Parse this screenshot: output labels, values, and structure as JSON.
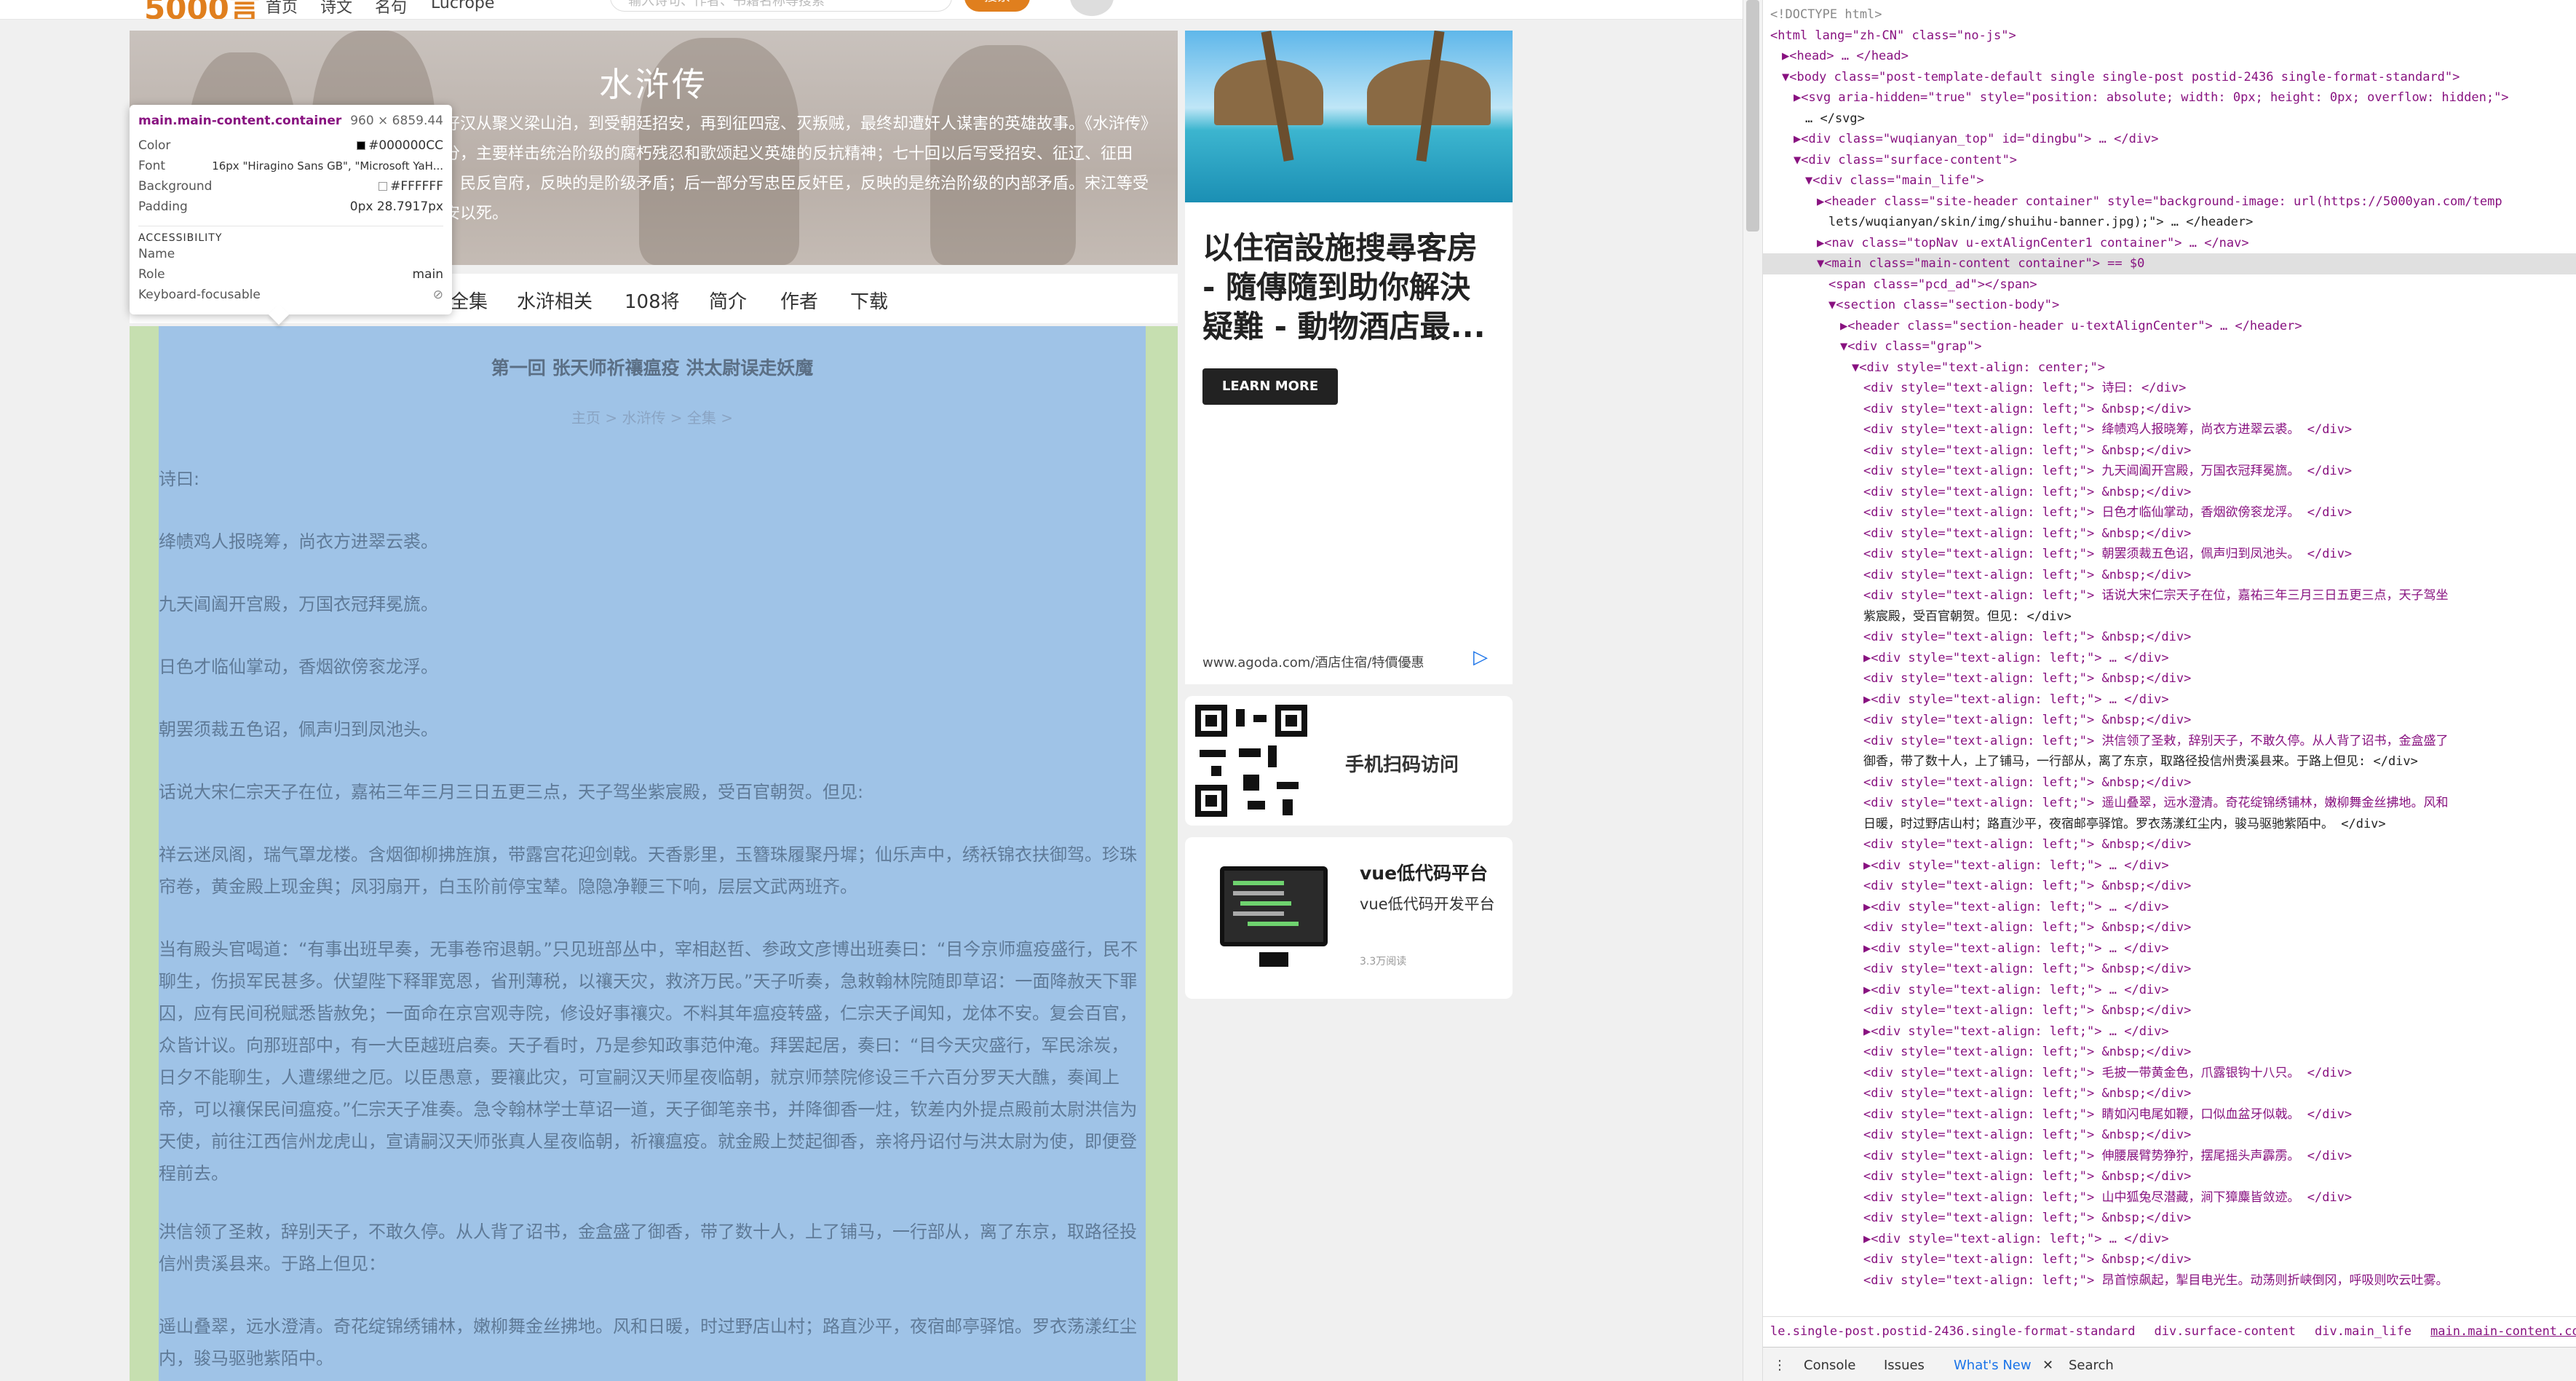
{
  "topbar": {
    "logo": "5000言",
    "nav": [
      "首页",
      "诗文",
      "名句",
      "Lucrope"
    ],
    "search_placeholder": "输入诗句、作者、书籍名称等搜索",
    "search_button": "搜索"
  },
  "banner": {
    "title": "水浒传",
    "text": "八好汉从聚义梁山泊，到受朝廷招安，再到征四寇、灭叛贼，最终却遭奸人谋害的英雄故事。《水浒传》部分，主要样击统治阶级的腐朽残忍和歌颂起义英雄的反抗精神；七十回以后写受招安、征辽、征田虎、民反官府，反映的是阶级矛盾；后一部分写忠臣反奸臣，反映的是统治阶级的内部矛盾。宋江等受招安以死。"
  },
  "tooltip": {
    "selector": "main.main-content.container",
    "dimensions": "960 × 6859.44",
    "rows": [
      {
        "k": "Color",
        "v": "#000000CC"
      },
      {
        "k": "Font",
        "v": "16px \"Hiragino Sans GB\", \"Microsoft YaH..."
      },
      {
        "k": "Background",
        "v": "#FFFFFF"
      },
      {
        "k": "Padding",
        "v": "0px 28.7917px"
      }
    ],
    "section": "ACCESSIBILITY",
    "acc_rows": [
      {
        "k": "Name",
        "v": ""
      },
      {
        "k": "Role",
        "v": "main"
      },
      {
        "k": "Keyboard-focusable",
        "v": "⊘"
      }
    ]
  },
  "subnav": [
    "全集",
    "水浒相关",
    "108将",
    "简介",
    "作者",
    "下载"
  ],
  "article": {
    "chapter_title": "第一回 张天师祈禳瘟疫 洪太尉误走妖魔",
    "breadcrumb": "主页 > 水浒传 > 全集 >",
    "paragraphs": [
      "诗曰:",
      "绛帻鸡人报晓筹，尚衣方进翠云裘。",
      "九天阊阖开宫殿，万国衣冠拜冕旒。",
      "日色才临仙掌动，香烟欲傍衮龙浮。",
      "朝罢须裁五色诏，佩声归到凤池头。",
      "话说大宋仁宗天子在位，嘉祐三年三月三日五更三点，天子驾坐紫宸殿，受百官朝贺。但见:",
      "祥云迷凤阁，瑞气罩龙楼。含烟御柳拂旌旗，带露宫花迎剑戟。天香影里，玉簪珠履聚丹墀；仙乐声中，绣袄锦衣扶御驾。珍珠帘卷，黄金殿上现金舆；凤羽扇开，白玉阶前停宝辇。隐隐净鞭三下响，层层文武两班齐。",
      "当有殿头官喝道：“有事出班早奏，无事卷帘退朝。”只见班部丛中，宰相赵哲、参政文彦博出班奏曰：“目今京师瘟疫盛行，民不聊生，伤损军民甚多。伏望陛下释罪宽恩，省刑薄税，以禳天灾，救济万民。”天子听奏，急敕翰林院随即草诏：一面降赦天下罪囚，应有民间税赋悉皆赦免；一面命在京宫观寺院，修设好事禳灾。不料其年瘟疫转盛，仁宗天子闻知，龙体不安。复会百官，众皆计议。向那班部中，有一大臣越班启奏。天子看时，乃是参知政事范仲淹。拜罢起居，奏曰：“目今天灾盛行，军民涂炭，日夕不能聊生，人遭缧绁之厄。以臣愚意，要禳此灾，可宣嗣汉天师星夜临朝，就京师禁院修设三千六百分罗天大醮，奏闻上帝，可以禳保民间瘟疫。”仁宗天子准奏。急令翰林学士草诏一道，天子御笔亲书，并降御香一炷，钦差内外提点殿前太尉洪信为天使，前往江西信州龙虎山，宣请嗣汉天师张真人星夜临朝，祈禳瘟疫。就金殿上焚起御香，亲将丹诏付与洪太尉为使，即便登程前去。",
      "洪信领了圣敕，辞别天子，不敢久停。从人背了诏书，金盒盛了御香，带了数十人，上了铺马，一行部从，离了东京，取路径投信州贵溪县来。于路上但见：",
      "遥山叠翠，远水澄清。奇花绽锦绣铺林，嫩柳舞金丝拂地。风和日暖，时过野店山村；路直沙平，夜宿邮亭驿馆。罗衣荡漾红尘内，骏马驱驰紫陌中。"
    ]
  },
  "ads": {
    "hotel_headline": "以住宿設施搜尋客房 - 隨傳隨到助你解決疑難 - 動物酒店最...",
    "hotel_cta": "LEARN MORE",
    "hotel_url": "www.agoda.com/酒店住宿/特價優惠",
    "qr_label": "手机扫码访问",
    "vue_title": "vue低代码平台",
    "vue_desc": "vue低代码开发平台",
    "vue_views": "3.3万阅读"
  },
  "devtools": {
    "lines": [
      {
        "i": 0,
        "t": "<!DOCTYPE html>",
        "k": "doctype"
      },
      {
        "i": 0,
        "t": "<html lang=\"zh-CN\" class=\"no-js\">",
        "k": "open"
      },
      {
        "i": 1,
        "t": "▶<head> … </head>",
        "k": "closed"
      },
      {
        "i": 1,
        "t": "▼<body class=\"post-template-default single single-post postid-2436 single-format-standard\">",
        "k": "open"
      },
      {
        "i": 2,
        "t": "▶<svg aria-hidden=\"true\" style=\"position: absolute; width: 0px; height: 0px; overflow: hidden;\">",
        "k": "closed"
      },
      {
        "i": 3,
        "t": "… </svg>",
        "k": "text"
      },
      {
        "i": 2,
        "t": "▶<div class=\"wuqianyan_top\" id=\"dingbu\"> … </div>",
        "k": "closed"
      },
      {
        "i": 2,
        "t": "▼<div class=\"surface-content\">",
        "k": "open"
      },
      {
        "i": 3,
        "t": "▼<div class=\"main_life\">",
        "k": "open"
      },
      {
        "i": 4,
        "t": "▶<header class=\"site-header container\" style=\"background-image: url(https://5000yan.com/temp",
        "k": "closed"
      },
      {
        "i": 5,
        "t": "lets/wuqianyan/skin/img/shuihu-banner.jpg);\"> … </header>",
        "k": "text"
      },
      {
        "i": 4,
        "t": "▶<nav class=\"topNav u-extAlignCenter1 container\"> … </nav>",
        "k": "closed"
      },
      {
        "i": 4,
        "t": "▼<main class=\"main-content container\"> == $0",
        "k": "sel"
      },
      {
        "i": 5,
        "t": "<span class=\"pcd_ad\"></span>",
        "k": "open"
      },
      {
        "i": 5,
        "t": "▼<section class=\"section-body\">",
        "k": "open"
      },
      {
        "i": 6,
        "t": "▶<header class=\"section-header u-textAlignCenter\"> … </header>",
        "k": "closed"
      },
      {
        "i": 6,
        "t": "▼<div class=\"grap\">",
        "k": "open"
      },
      {
        "i": 7,
        "t": "▼<div style=\"text-align: center;\">",
        "k": "open"
      },
      {
        "i": 8,
        "t": "<div style=\"text-align: left;\"> 诗曰: </div>",
        "k": "leaf"
      },
      {
        "i": 8,
        "t": "<div style=\"text-align: left;\"> &nbsp;</div>",
        "k": "leaf"
      },
      {
        "i": 8,
        "t": "<div style=\"text-align: left;\"> 绛帻鸡人报晓筹，尚衣方进翠云裘。 </div>",
        "k": "leaf"
      },
      {
        "i": 8,
        "t": "<div style=\"text-align: left;\"> &nbsp;</div>",
        "k": "leaf"
      },
      {
        "i": 8,
        "t": "<div style=\"text-align: left;\"> 九天阊阖开宫殿，万国衣冠拜冕旒。 </div>",
        "k": "leaf"
      },
      {
        "i": 8,
        "t": "<div style=\"text-align: left;\"> &nbsp;</div>",
        "k": "leaf"
      },
      {
        "i": 8,
        "t": "<div style=\"text-align: left;\"> 日色才临仙掌动，香烟欲傍衮龙浮。 </div>",
        "k": "leaf"
      },
      {
        "i": 8,
        "t": "<div style=\"text-align: left;\"> &nbsp;</div>",
        "k": "leaf"
      },
      {
        "i": 8,
        "t": "<div style=\"text-align: left;\"> 朝罢须裁五色诏，佩声归到凤池头。 </div>",
        "k": "leaf"
      },
      {
        "i": 8,
        "t": "<div style=\"text-align: left;\"> &nbsp;</div>",
        "k": "leaf"
      },
      {
        "i": 8,
        "t": "<div style=\"text-align: left;\"> 话说大宋仁宗天子在位，嘉祐三年三月三日五更三点，天子驾坐",
        "k": "leaf"
      },
      {
        "i": 8,
        "t": "紫宸殿，受百官朝贺。但见: </div>",
        "k": "text"
      },
      {
        "i": 8,
        "t": "<div style=\"text-align: left;\"> &nbsp;</div>",
        "k": "leaf"
      },
      {
        "i": 8,
        "t": "▶<div style=\"text-align: left;\"> … </div>",
        "k": "closed"
      },
      {
        "i": 8,
        "t": "<div style=\"text-align: left;\"> &nbsp;</div>",
        "k": "leaf"
      },
      {
        "i": 8,
        "t": "▶<div style=\"text-align: left;\"> … </div>",
        "k": "closed"
      },
      {
        "i": 8,
        "t": "<div style=\"text-align: left;\"> &nbsp;</div>",
        "k": "leaf"
      },
      {
        "i": 8,
        "t": "<div style=\"text-align: left;\"> 洪信领了圣敕，辞别天子，不敢久停。从人背了诏书，金盒盛了",
        "k": "leaf"
      },
      {
        "i": 8,
        "t": "御香，带了数十人，上了铺马，一行部从，离了东京，取路径投信州贵溪县来。于路上但见: </div>",
        "k": "text"
      },
      {
        "i": 8,
        "t": "<div style=\"text-align: left;\"> &nbsp;</div>",
        "k": "leaf"
      },
      {
        "i": 8,
        "t": "<div style=\"text-align: left;\"> 遥山叠翠，远水澄清。奇花绽锦绣铺林，嫩柳舞金丝拂地。风和",
        "k": "leaf"
      },
      {
        "i": 8,
        "t": "日暖，时过野店山村；路直沙平，夜宿邮亭驿馆。罗衣荡漾红尘内，骏马驱驰紫陌中。 </div>",
        "k": "text"
      },
      {
        "i": 8,
        "t": "<div style=\"text-align: left;\"> &nbsp;</div>",
        "k": "leaf"
      },
      {
        "i": 8,
        "t": "▶<div style=\"text-align: left;\"> … </div>",
        "k": "closed"
      },
      {
        "i": 8,
        "t": "<div style=\"text-align: left;\"> &nbsp;</div>",
        "k": "leaf"
      },
      {
        "i": 8,
        "t": "▶<div style=\"text-align: left;\"> … </div>",
        "k": "closed"
      },
      {
        "i": 8,
        "t": "<div style=\"text-align: left;\"> &nbsp;</div>",
        "k": "leaf"
      },
      {
        "i": 8,
        "t": "▶<div style=\"text-align: left;\"> … </div>",
        "k": "closed"
      },
      {
        "i": 8,
        "t": "<div style=\"text-align: left;\"> &nbsp;</div>",
        "k": "leaf"
      },
      {
        "i": 8,
        "t": "▶<div style=\"text-align: left;\"> … </div>",
        "k": "closed"
      },
      {
        "i": 8,
        "t": "<div style=\"text-align: left;\"> &nbsp;</div>",
        "k": "leaf"
      },
      {
        "i": 8,
        "t": "▶<div style=\"text-align: left;\"> … </div>",
        "k": "closed"
      },
      {
        "i": 8,
        "t": "<div style=\"text-align: left;\"> &nbsp;</div>",
        "k": "leaf"
      },
      {
        "i": 8,
        "t": "<div style=\"text-align: left;\"> 毛披一带黄金色，爪露银钩十八只。 </div>",
        "k": "leaf"
      },
      {
        "i": 8,
        "t": "<div style=\"text-align: left;\"> &nbsp;</div>",
        "k": "leaf"
      },
      {
        "i": 8,
        "t": "<div style=\"text-align: left;\"> 睛如闪电尾如鞭，口似血盆牙似戟。 </div>",
        "k": "leaf"
      },
      {
        "i": 8,
        "t": "<div style=\"text-align: left;\"> &nbsp;</div>",
        "k": "leaf"
      },
      {
        "i": 8,
        "t": "<div style=\"text-align: left;\"> 伸腰展臂势狰狞，摆尾摇头声霹雳。 </div>",
        "k": "leaf"
      },
      {
        "i": 8,
        "t": "<div style=\"text-align: left;\"> &nbsp;</div>",
        "k": "leaf"
      },
      {
        "i": 8,
        "t": "<div style=\"text-align: left;\"> 山中狐兔尽潜藏，涧下獐麋皆敛迹。 </div>",
        "k": "leaf"
      },
      {
        "i": 8,
        "t": "<div style=\"text-align: left;\"> &nbsp;</div>",
        "k": "leaf"
      },
      {
        "i": 8,
        "t": "▶<div style=\"text-align: left;\"> … </div>",
        "k": "closed"
      },
      {
        "i": 8,
        "t": "<div style=\"text-align: left;\"> &nbsp;</div>",
        "k": "leaf"
      },
      {
        "i": 8,
        "t": "<div style=\"text-align: left;\"> 昂首惊飙起，掣目电光生。动荡则折峡倒冈，呼吸则吹云吐雾。",
        "k": "leaf"
      }
    ],
    "breadcrumbs": [
      "le.single-post.postid-2436.single-format-standard",
      "div.surface-content",
      "div.main_life",
      "main.main-content.container"
    ],
    "drawer_tabs": [
      "Console",
      "Issues",
      "What's New",
      "Search"
    ]
  }
}
